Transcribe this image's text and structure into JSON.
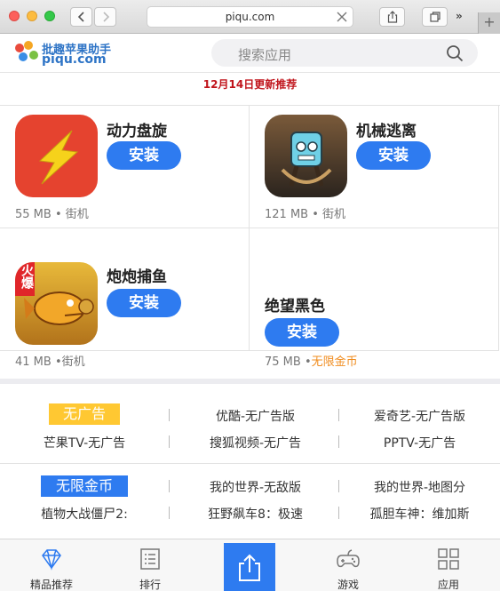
{
  "browser": {
    "url": "piqu.com"
  },
  "site": {
    "logo_line1": "批趣苹果助手",
    "logo_line2": "piqu.com",
    "search_placeholder": "搜索应用"
  },
  "date_banner": "12月14日更新推荐",
  "apps": [
    {
      "name": "动力盘旋",
      "install": "安装",
      "size": "55 MB",
      "category": "街机",
      "highlight": ""
    },
    {
      "name": "机械逃离",
      "install": "安装",
      "size": "121 MB",
      "category": "街机",
      "highlight": ""
    },
    {
      "name": "炮炮捕鱼",
      "install": "安装",
      "size": "41 MB",
      "category": "街机",
      "highlight": "",
      "badge": "火爆"
    },
    {
      "name": "绝望黑色",
      "install": "安装",
      "size": "75 MB",
      "category": "",
      "highlight": "无限金币"
    }
  ],
  "categories": [
    {
      "tag": "无广告",
      "tag_bg": "#ffc832",
      "tag_color": "#ffffff",
      "links": [
        "优酷-无广告版",
        "爱奇艺-无广告版",
        "芒果TV-无广告",
        "搜狐视频-无广告",
        "PPTV-无广告"
      ]
    },
    {
      "tag": "无限金币",
      "tag_bg": "#2e7bf0",
      "tag_color": "#ffffff",
      "links": [
        "我的世界-无敌版",
        "我的世界-地图分",
        "植物大战僵尸2:",
        "狂野飙车8：极速",
        "孤胆车神：维加斯"
      ]
    }
  ],
  "tabs": [
    {
      "label": "精品推荐",
      "icon": "diamond-icon"
    },
    {
      "label": "排行",
      "icon": "list-icon"
    },
    {
      "label": "",
      "icon": "share-icon"
    },
    {
      "label": "游戏",
      "icon": "gamepad-icon"
    },
    {
      "label": "应用",
      "icon": "grid-icon"
    }
  ]
}
